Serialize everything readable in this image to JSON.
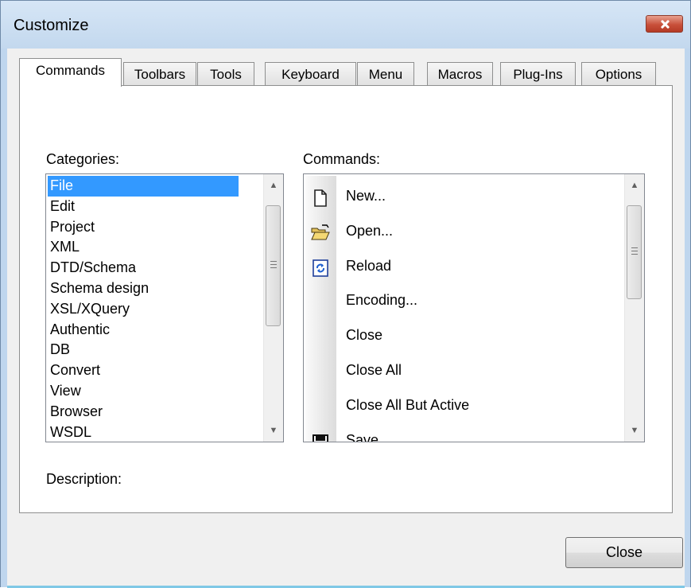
{
  "window": {
    "title": "Customize"
  },
  "tabs": [
    {
      "label": "Commands",
      "active": true
    },
    {
      "label": "Toolbars"
    },
    {
      "label": "Tools"
    },
    {
      "label": "Keyboard"
    },
    {
      "label": "Menu"
    },
    {
      "label": "Macros"
    },
    {
      "label": "Plug-Ins"
    },
    {
      "label": "Options"
    }
  ],
  "categories": {
    "label": "Categories:",
    "selected": "File",
    "items": [
      "File",
      "Edit",
      "Project",
      "XML",
      "DTD/Schema",
      "Schema design",
      "XSL/XQuery",
      "Authentic",
      "DB",
      "Convert",
      "View",
      "Browser",
      "WSDL"
    ]
  },
  "commands": {
    "label": "Commands:",
    "items": [
      {
        "label": "New...",
        "icon": "new-document-icon"
      },
      {
        "label": "Open...",
        "icon": "open-folder-icon"
      },
      {
        "label": "Reload",
        "icon": "reload-icon"
      },
      {
        "label": "Encoding...",
        "icon": ""
      },
      {
        "label": "Close",
        "icon": ""
      },
      {
        "label": "Close All",
        "icon": ""
      },
      {
        "label": "Close All But Active",
        "icon": ""
      },
      {
        "label": "Save",
        "icon": "save-icon"
      }
    ]
  },
  "description": {
    "label": "Description:"
  },
  "footer": {
    "close_label": "Close"
  },
  "colors": {
    "selection": "#3399ff",
    "titlebar": "#c3d8ee",
    "close_button": "#c8503a"
  }
}
